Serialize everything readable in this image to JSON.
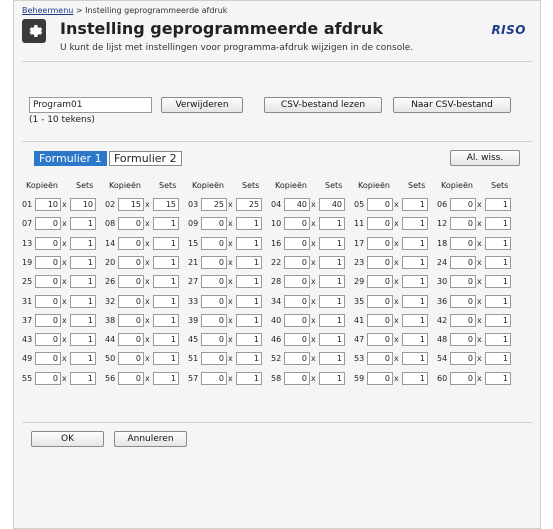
{
  "breadcrumb": {
    "link": "Beheermenu",
    "sep": ">",
    "current": "Instelling geprogrammeerde afdruk"
  },
  "title": "Instelling geprogrammeerde afdruk",
  "subtitle": "U kunt de lijst met instellingen voor programma-afdruk wijzigen in de console.",
  "logo": "RISO",
  "program": {
    "name_value": "Program01",
    "hint": "(1 - 10 tekens)"
  },
  "buttons": {
    "delete": "Verwijderen",
    "read_csv": "CSV-bestand lezen",
    "to_csv": "Naar CSV-bestand",
    "clear_all": "Al. wiss.",
    "ok": "OK",
    "cancel": "Annuleren"
  },
  "tabs": [
    {
      "label": "Formulier 1"
    },
    {
      "label": "Formulier 2"
    }
  ],
  "headers": {
    "copies": "Kopieën",
    "sets": "Sets",
    "x": "x"
  },
  "entries": [
    {
      "n": "01",
      "c": "10",
      "s": "10"
    },
    {
      "n": "02",
      "c": "15",
      "s": "15"
    },
    {
      "n": "03",
      "c": "25",
      "s": "25"
    },
    {
      "n": "04",
      "c": "40",
      "s": "40"
    },
    {
      "n": "05",
      "c": "0",
      "s": "1"
    },
    {
      "n": "06",
      "c": "0",
      "s": "1"
    },
    {
      "n": "07",
      "c": "0",
      "s": "1"
    },
    {
      "n": "08",
      "c": "0",
      "s": "1"
    },
    {
      "n": "09",
      "c": "0",
      "s": "1"
    },
    {
      "n": "10",
      "c": "0",
      "s": "1"
    },
    {
      "n": "11",
      "c": "0",
      "s": "1"
    },
    {
      "n": "12",
      "c": "0",
      "s": "1"
    },
    {
      "n": "13",
      "c": "0",
      "s": "1"
    },
    {
      "n": "14",
      "c": "0",
      "s": "1"
    },
    {
      "n": "15",
      "c": "0",
      "s": "1"
    },
    {
      "n": "16",
      "c": "0",
      "s": "1"
    },
    {
      "n": "17",
      "c": "0",
      "s": "1"
    },
    {
      "n": "18",
      "c": "0",
      "s": "1"
    },
    {
      "n": "19",
      "c": "0",
      "s": "1"
    },
    {
      "n": "20",
      "c": "0",
      "s": "1"
    },
    {
      "n": "21",
      "c": "0",
      "s": "1"
    },
    {
      "n": "22",
      "c": "0",
      "s": "1"
    },
    {
      "n": "23",
      "c": "0",
      "s": "1"
    },
    {
      "n": "24",
      "c": "0",
      "s": "1"
    },
    {
      "n": "25",
      "c": "0",
      "s": "1"
    },
    {
      "n": "26",
      "c": "0",
      "s": "1"
    },
    {
      "n": "27",
      "c": "0",
      "s": "1"
    },
    {
      "n": "28",
      "c": "0",
      "s": "1"
    },
    {
      "n": "29",
      "c": "0",
      "s": "1"
    },
    {
      "n": "30",
      "c": "0",
      "s": "1"
    },
    {
      "n": "31",
      "c": "0",
      "s": "1"
    },
    {
      "n": "32",
      "c": "0",
      "s": "1"
    },
    {
      "n": "33",
      "c": "0",
      "s": "1"
    },
    {
      "n": "34",
      "c": "0",
      "s": "1"
    },
    {
      "n": "35",
      "c": "0",
      "s": "1"
    },
    {
      "n": "36",
      "c": "0",
      "s": "1"
    },
    {
      "n": "37",
      "c": "0",
      "s": "1"
    },
    {
      "n": "38",
      "c": "0",
      "s": "1"
    },
    {
      "n": "39",
      "c": "0",
      "s": "1"
    },
    {
      "n": "40",
      "c": "0",
      "s": "1"
    },
    {
      "n": "41",
      "c": "0",
      "s": "1"
    },
    {
      "n": "42",
      "c": "0",
      "s": "1"
    },
    {
      "n": "43",
      "c": "0",
      "s": "1"
    },
    {
      "n": "44",
      "c": "0",
      "s": "1"
    },
    {
      "n": "45",
      "c": "0",
      "s": "1"
    },
    {
      "n": "46",
      "c": "0",
      "s": "1"
    },
    {
      "n": "47",
      "c": "0",
      "s": "1"
    },
    {
      "n": "48",
      "c": "0",
      "s": "1"
    },
    {
      "n": "49",
      "c": "0",
      "s": "1"
    },
    {
      "n": "50",
      "c": "0",
      "s": "1"
    },
    {
      "n": "51",
      "c": "0",
      "s": "1"
    },
    {
      "n": "52",
      "c": "0",
      "s": "1"
    },
    {
      "n": "53",
      "c": "0",
      "s": "1"
    },
    {
      "n": "54",
      "c": "0",
      "s": "1"
    },
    {
      "n": "55",
      "c": "0",
      "s": "1"
    },
    {
      "n": "56",
      "c": "0",
      "s": "1"
    },
    {
      "n": "57",
      "c": "0",
      "s": "1"
    },
    {
      "n": "58",
      "c": "0",
      "s": "1"
    },
    {
      "n": "59",
      "c": "0",
      "s": "1"
    },
    {
      "n": "60",
      "c": "0",
      "s": "1"
    }
  ],
  "colors": {
    "tab_active": "#2b78c9",
    "logo": "#1f3c8a",
    "breadcrumb_link": "#1a3a8a"
  }
}
